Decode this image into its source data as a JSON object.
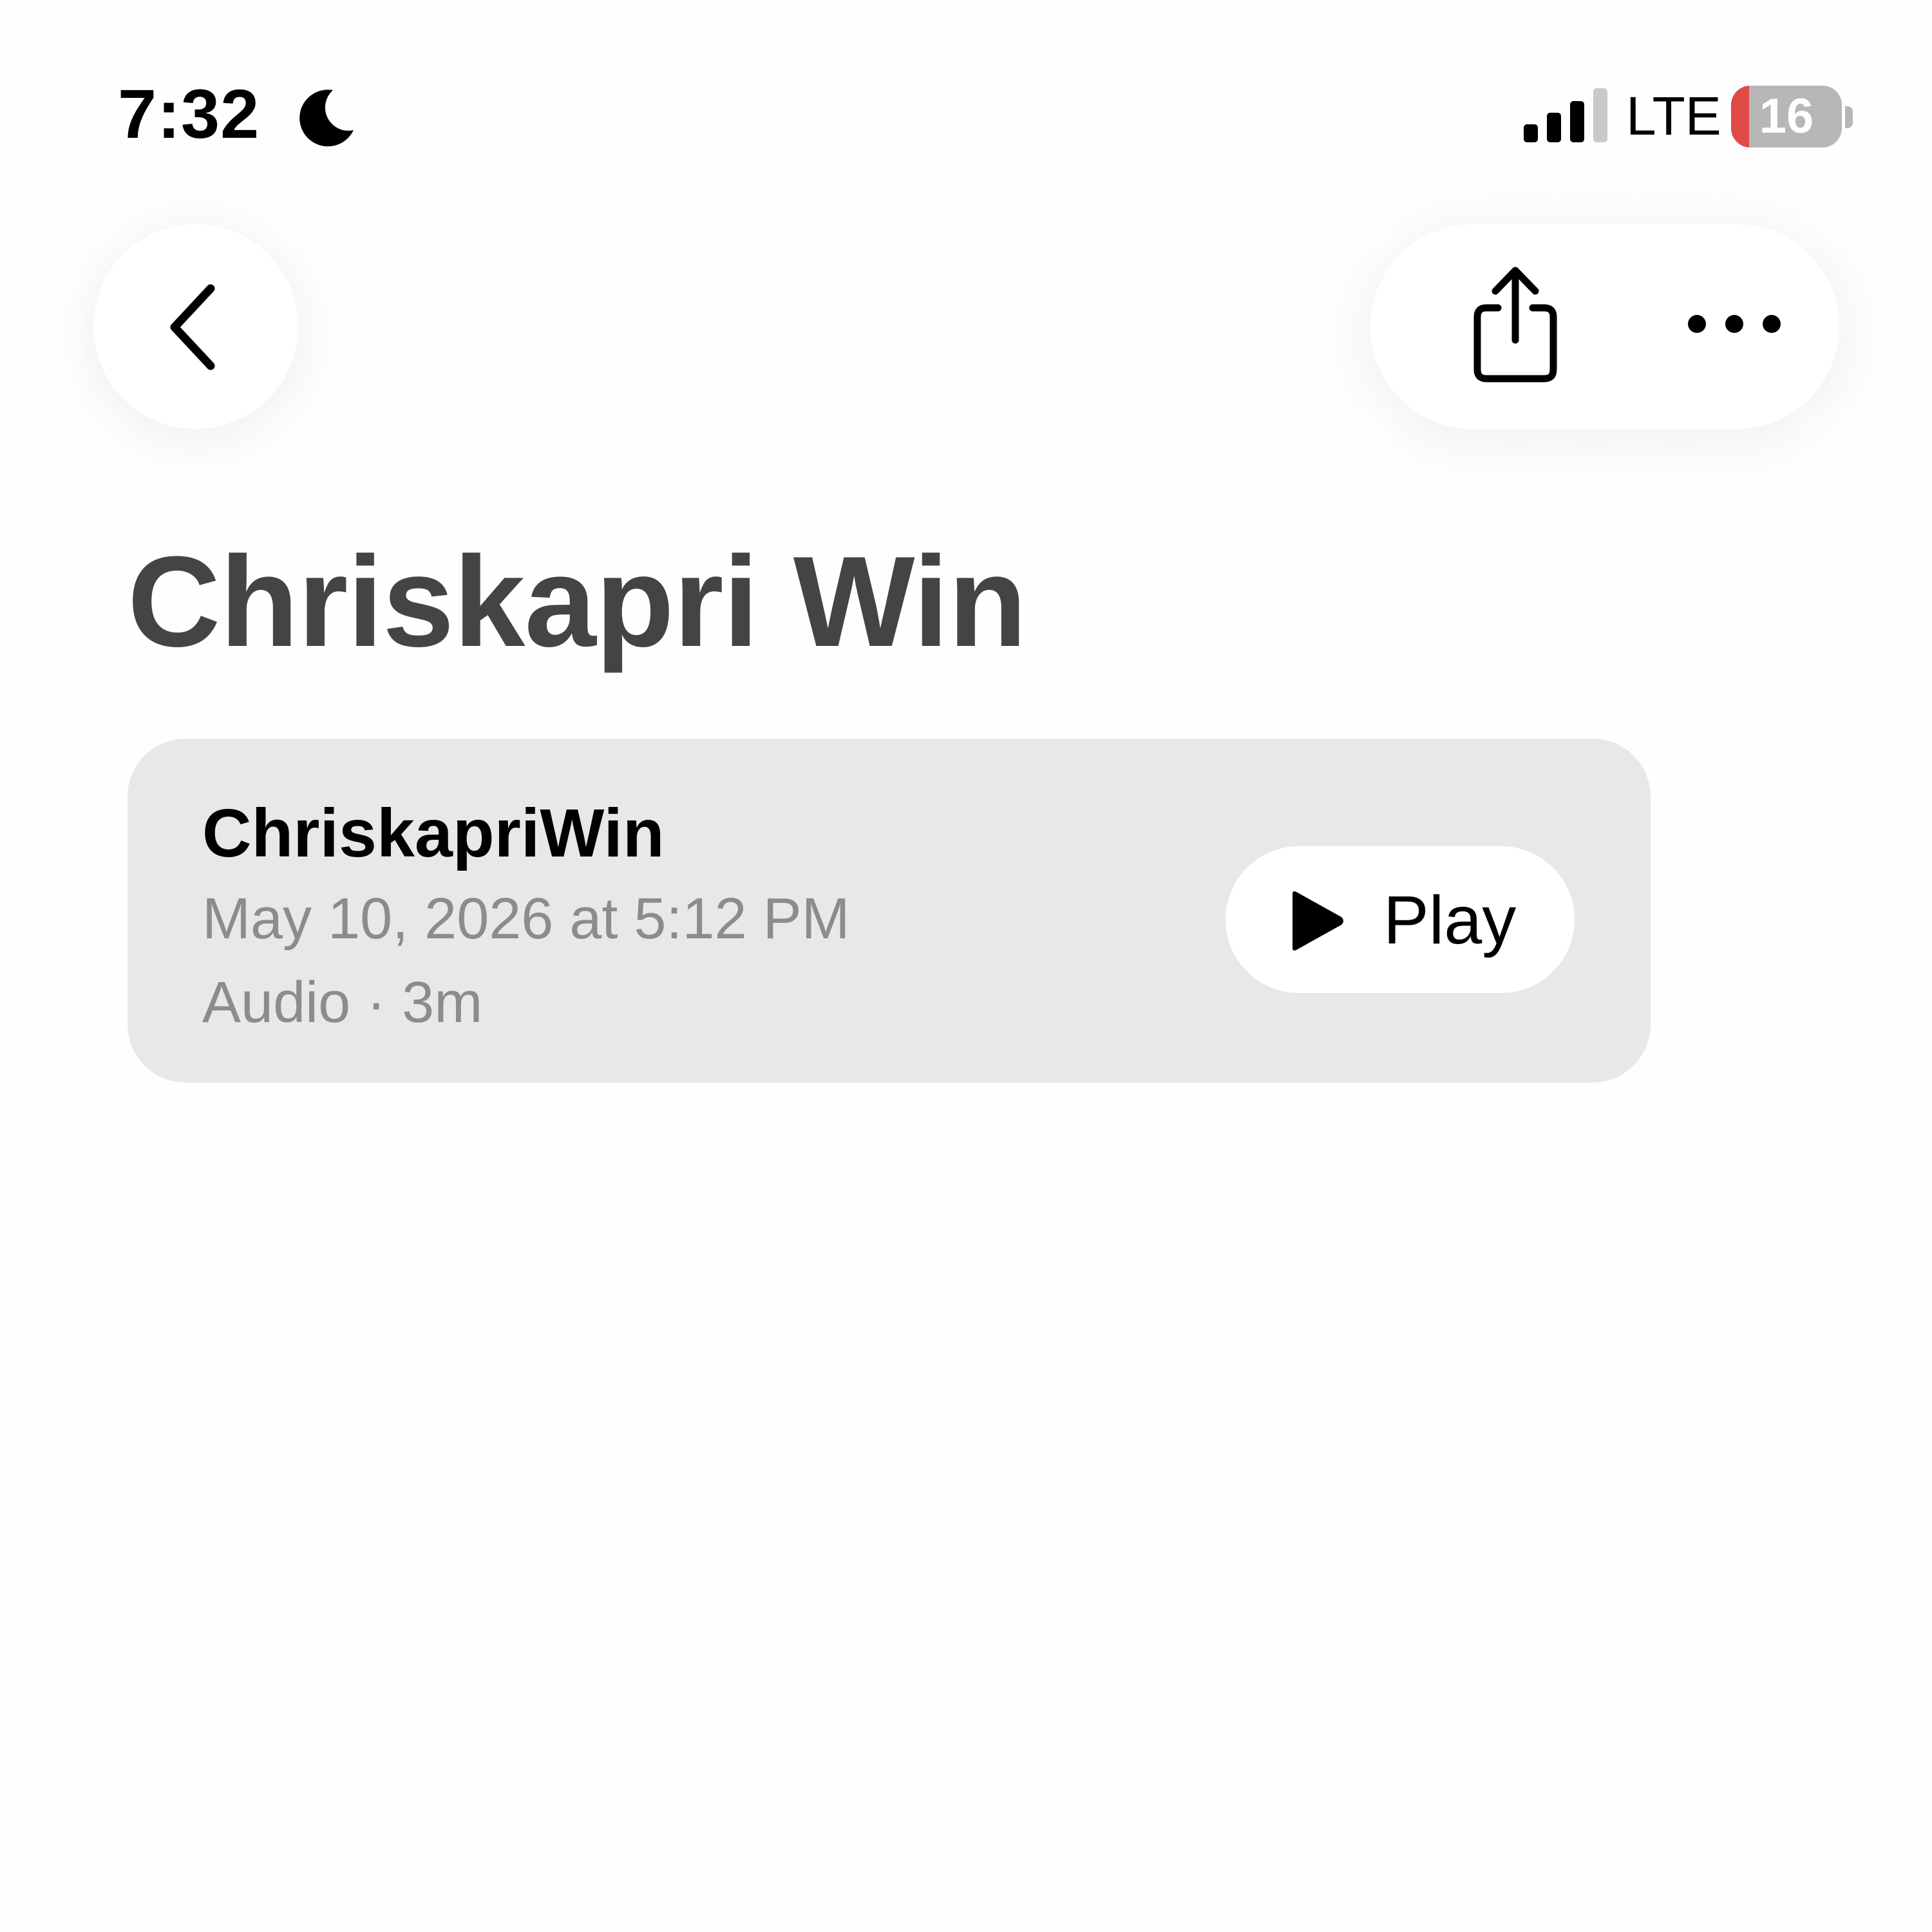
{
  "status_bar": {
    "time": "7:32",
    "focus_icon": "moon-icon",
    "signal_icon": "cellular-signal-icon",
    "network": "LTE",
    "battery_level": "16",
    "battery_color": "#e04a44"
  },
  "nav": {
    "back_icon": "chevron-left-icon",
    "share_icon": "share-icon",
    "more_icon": "ellipsis-icon"
  },
  "page": {
    "title": "Chriskapri Win"
  },
  "recording": {
    "name": "ChriskapriWin",
    "date": "May 10, 2026 at 5:12 PM",
    "meta": "Audio · 3m",
    "play_label": "Play",
    "play_icon": "play-icon"
  },
  "colors": {
    "card_background": "#e8e8e8",
    "title_color": "#444444",
    "secondary_text": "#8c8c8c"
  }
}
